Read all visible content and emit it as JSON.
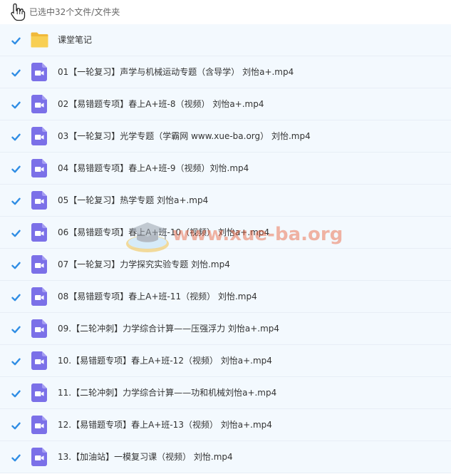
{
  "header": {
    "selection_text": "已选中32个文件/文件夹"
  },
  "watermark": {
    "text": "www.xue-ba.org"
  },
  "colors": {
    "row_bg": "#f3f9fe",
    "checkbox": "#2f8de4",
    "video_icon": "#7b70e8",
    "folder": "#f8cf53"
  },
  "items": [
    {
      "type": "folder",
      "icon": "folder-icon",
      "checked": true,
      "name": "课堂笔记"
    },
    {
      "type": "video",
      "icon": "video-file-icon",
      "checked": true,
      "name": "01【一轮复习】声学与机械运动专题（含导学） 刘怡a+.mp4"
    },
    {
      "type": "video",
      "icon": "video-file-icon",
      "checked": true,
      "name": "02【易错题专项】春上A+班-8（视频） 刘怡a+.mp4"
    },
    {
      "type": "video",
      "icon": "video-file-icon",
      "checked": true,
      "name": "03【一轮复习】光学专题（学霸网 www.xue-ba.org） 刘怡.mp4"
    },
    {
      "type": "video",
      "icon": "video-file-icon",
      "checked": true,
      "name": "04【易错题专项】春上A+班-9（视频）刘怡.mp4"
    },
    {
      "type": "video",
      "icon": "video-file-icon",
      "checked": true,
      "name": "05【一轮复习】热学专题 刘怡a+.mp4"
    },
    {
      "type": "video",
      "icon": "video-file-icon",
      "checked": true,
      "name": "06【易错题专项】春上A+班-10（视频） 刘怡a+.mp4"
    },
    {
      "type": "video",
      "icon": "video-file-icon",
      "checked": true,
      "name": "07【一轮复习】力学探究实验专题 刘怡.mp4"
    },
    {
      "type": "video",
      "icon": "video-file-icon",
      "checked": true,
      "name": "08【易错题专项】春上A+班-11（视频） 刘怡.mp4"
    },
    {
      "type": "video",
      "icon": "video-file-icon",
      "checked": true,
      "name": "09.【二轮冲刺】力学综合计算——压强浮力 刘怡a+.mp4"
    },
    {
      "type": "video",
      "icon": "video-file-icon",
      "checked": true,
      "name": "10.【易错题专项】春上A+班-12（视频） 刘怡a+.mp4"
    },
    {
      "type": "video",
      "icon": "video-file-icon",
      "checked": true,
      "name": "11.【二轮冲刺】力学综合计算——功和机械刘怡a+.mp4"
    },
    {
      "type": "video",
      "icon": "video-file-icon",
      "checked": true,
      "name": "12.【易错题专项】春上A+班-13（视频） 刘怡a+.mp4"
    },
    {
      "type": "video",
      "icon": "video-file-icon",
      "checked": true,
      "name": "13.【加油站】一模复习课（视频） 刘怡.mp4"
    }
  ]
}
